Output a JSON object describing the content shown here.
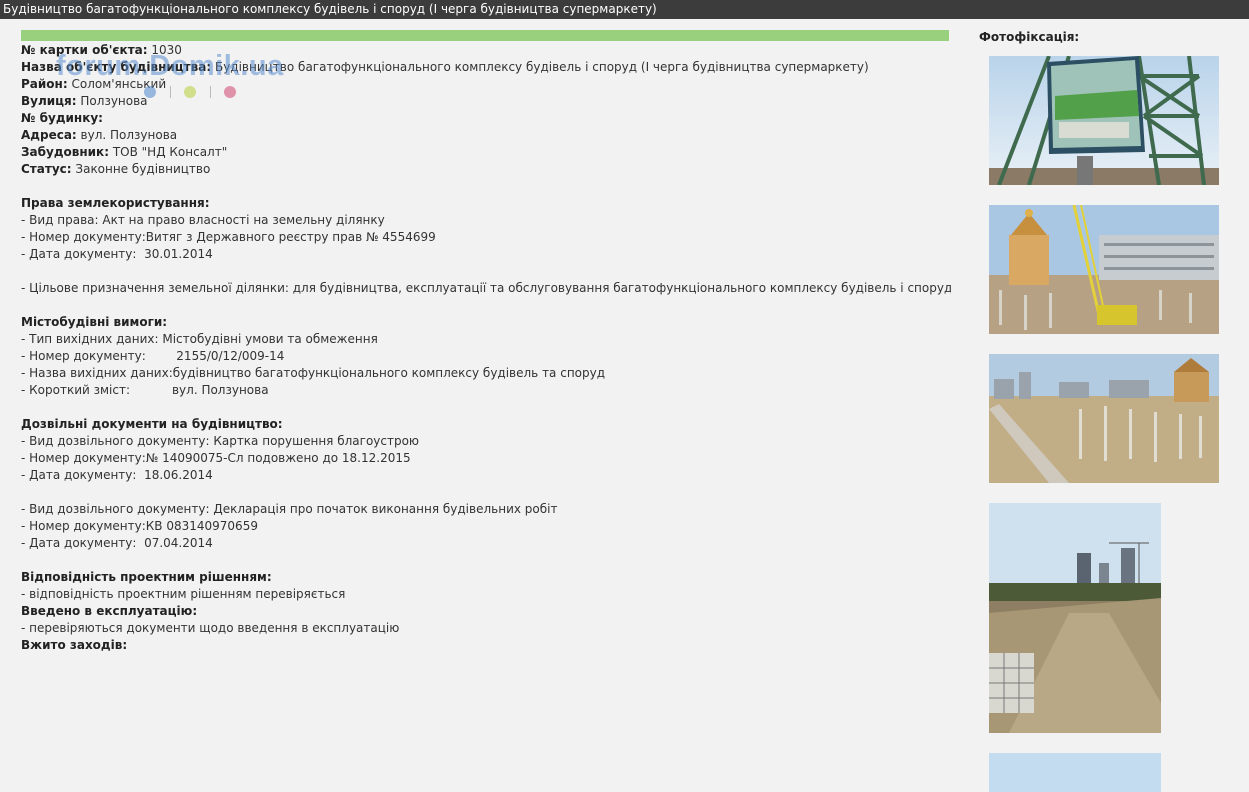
{
  "window": {
    "title": "Будівництво багатофункціонального комплексу будівель і споруд (І черга будівництва супермаркету)"
  },
  "watermark": {
    "text": "forum.Domik.ua"
  },
  "object": {
    "card_no_label": "№ картки об'єкта:",
    "card_no": "1030",
    "name_label": "Назва об'єкту будівництва:",
    "name": "Будівництво багатофункціонального комплексу будівель і споруд (І черга будівництва супермаркету)",
    "district_label": "Район:",
    "district": "Солом'янський",
    "street_label": "Вулиця:",
    "street": "Ползунова",
    "house_label": "№ будинку:",
    "house": "",
    "address_label": "Адреса:",
    "address": "вул. Ползунова",
    "developer_label": "Забудовник:",
    "developer": "ТОВ \"НД Консалт\"",
    "status_label": "Статус:",
    "status": "Законне будівництво"
  },
  "land": {
    "heading": "Права землекористування:",
    "right_type": "- Вид права: Акт на право власності на земельну ділянку",
    "doc_no": "- Номер документу:Витяг з Державного реєстру прав № 4554699",
    "doc_date": "- Дата документу:  30.01.2014",
    "purpose": "- Цільове призначення земельної ділянки: для будівництва, експлуатації та обслуговування багатофункціонального комплексу будівель і споруд"
  },
  "urban": {
    "heading": "Містобудівні вимоги:",
    "source_type": "- Тип вихідних даних: Містобудівні умови та обмеження",
    "doc_no": "- Номер документу:        2155/0/12/009-14",
    "source_name": "- Назва вихідних даних:будівництво багатофункціонального комплексу будівель та споруд",
    "summary": "- Короткий зміст:           вул. Ползунова"
  },
  "permits": {
    "heading": "Дозвільні документи на будівництво:",
    "p1_type": "- Вид дозвільного документу: Картка порушення благоустрою",
    "p1_no": "- Номер документу:№ 14090075-Сл подовжено до 18.12.2015",
    "p1_date": "- Дата документу:  18.06.2014",
    "p2_type": "- Вид дозвільного документу: Декларація про початок виконання будівельних робіт",
    "p2_no": "- Номер документу:КВ 083140970659",
    "p2_date": "- Дата документу:  07.04.2014"
  },
  "compliance": {
    "heading": "Відповідність проектним рішенням:",
    "text": "- відповідність проектним рішенням перевіряється",
    "commission_heading": "Введено в експлуатацію:",
    "commission_text": "- перевіряються документи щодо введення в експлуатацію",
    "measures_heading": "Вжито заходів:"
  },
  "photos": {
    "title": "Фотофіксація:"
  },
  "colors": {
    "titlebar": "#3c3c3c",
    "progress": "#98d07e",
    "background": "#f2f2f2"
  }
}
